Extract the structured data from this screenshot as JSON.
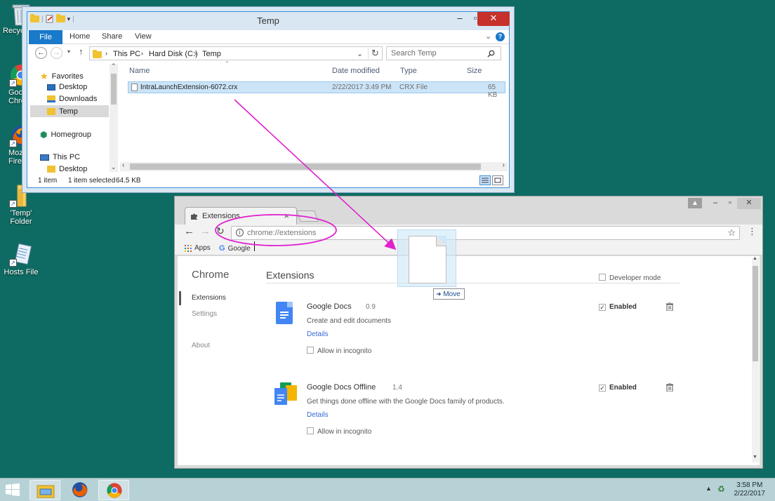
{
  "desktop": {
    "icons": [
      {
        "label": "Recycle"
      },
      {
        "label": "Goog\nChror"
      },
      {
        "label": "Mozi\nFirefo"
      },
      {
        "label": "'Temp'\nFolder"
      },
      {
        "label": "Hosts File"
      }
    ]
  },
  "explorer": {
    "title": "Temp",
    "ribbon_tabs": {
      "file": "File",
      "home": "Home",
      "share": "Share",
      "view": "View"
    },
    "breadcrumb": [
      "This PC",
      "Hard Disk (C:)",
      "Temp"
    ],
    "search_placeholder": "Search Temp",
    "nav": {
      "favorites": "Favorites",
      "desktop": "Desktop",
      "downloads": "Downloads",
      "temp": "Temp",
      "homegroup": "Homegroup",
      "this_pc": "This PC",
      "desktop2": "Desktop"
    },
    "columns": {
      "name": "Name",
      "date": "Date modified",
      "type": "Type",
      "size": "Size"
    },
    "file": {
      "name": "IntraLaunchExtension-6072.crx",
      "date": "2/22/2017 3:49 PM",
      "type": "CRX File",
      "size": "65 KB"
    },
    "status": {
      "count": "1 item",
      "selected": "1 item selected",
      "size": "64.5 KB"
    }
  },
  "chrome": {
    "tab_title": "Extensions",
    "url": "chrome://extensions",
    "bookmarks": {
      "apps": "Apps",
      "google": "Google"
    },
    "sidebar": {
      "brand": "Chrome",
      "extensions": "Extensions",
      "settings": "Settings",
      "about": "About"
    },
    "page_title": "Extensions",
    "developer_mode": "Developer mode",
    "extensions": [
      {
        "name": "Google Docs",
        "version": "0.9",
        "description": "Create and edit documents",
        "details": "Details",
        "incognito": "Allow in incognito",
        "enabled": "Enabled"
      },
      {
        "name": "Google Docs Offline",
        "version": "1.4",
        "description": "Get things done offline with the Google Docs family of products.",
        "details": "Details",
        "incognito": "Allow in incognito",
        "enabled": "Enabled"
      }
    ]
  },
  "drag": {
    "label": "Move"
  },
  "taskbar": {
    "time": "3:58 PM",
    "date": "2/22/2017"
  },
  "colors": {
    "desktop": "#0e6b63",
    "annotation": "#e020d0",
    "explorer_accent": "#1979ca",
    "close_red": "#c7312b"
  }
}
